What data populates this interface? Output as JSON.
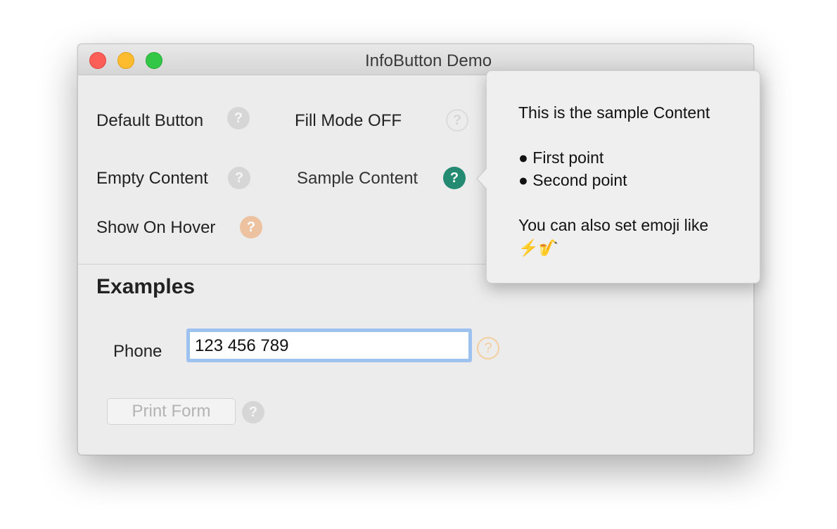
{
  "window": {
    "title": "InfoButton Demo"
  },
  "demo": {
    "default_button_label": "Default Button",
    "fill_mode_label": "Fill Mode OFF",
    "empty_content_label": "Empty Content",
    "sample_content_label": "Sample Content",
    "show_on_hover_label": "Show On Hover",
    "info_glyph": "?"
  },
  "popover": {
    "line1": "This is the sample Content",
    "bullet1": "● First point",
    "bullet2": "● Second point",
    "line2": "You can also set emoji like",
    "emoji": "⚡️🎷"
  },
  "examples": {
    "title": "Examples",
    "phone_label": "Phone",
    "phone_value": "123 456 789",
    "print_button": "Print Form"
  },
  "colors": {
    "accent_teal": "#248b72",
    "peach": "#ecc2a1",
    "focus_ring": "#9ec2ef"
  }
}
